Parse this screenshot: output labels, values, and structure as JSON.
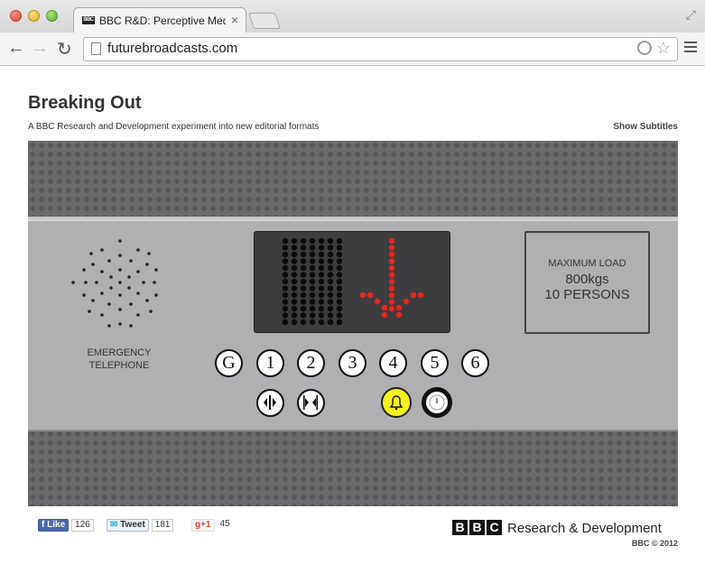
{
  "browser": {
    "tab_title": "BBC R&D: Perceptive Media",
    "tab_favicon_text": "BBC",
    "tab_close": "×",
    "url": "futurebroadcasts.com",
    "back": "←",
    "forward": "→",
    "reload": "↻",
    "star": "☆",
    "fullscreen": "⤢"
  },
  "page": {
    "title": "Breaking Out",
    "subtitle": "A BBC Research and Development experiment into new editorial formats",
    "show_subtitles": "Show Subtitles"
  },
  "elevator": {
    "emergency_label_1": "EMERGENCY",
    "emergency_label_2": "TELEPHONE",
    "load_title": "MAXIMUM LOAD",
    "load_weight": "800kgs",
    "load_persons": "10 PERSONS",
    "floors": [
      "G",
      "1",
      "2",
      "3",
      "4",
      "5",
      "6"
    ],
    "direction": "down",
    "arrow_color": "#e8261f",
    "display_bg": "#3d3d3f",
    "alarm_color": "#f4f21a",
    "icons": [
      "door-open-icon",
      "door-close-icon",
      "bell-icon",
      "key-icon"
    ]
  },
  "footer": {
    "like_label": "Like",
    "like_count": "126",
    "tweet_label": "Tweet",
    "tweet_count": "181",
    "plusone_label": "+1",
    "plusone_count": "45",
    "bbc_letters": [
      "B",
      "B",
      "C"
    ],
    "rd_text": "Research & Development",
    "copyright": "BBC © 2012"
  }
}
